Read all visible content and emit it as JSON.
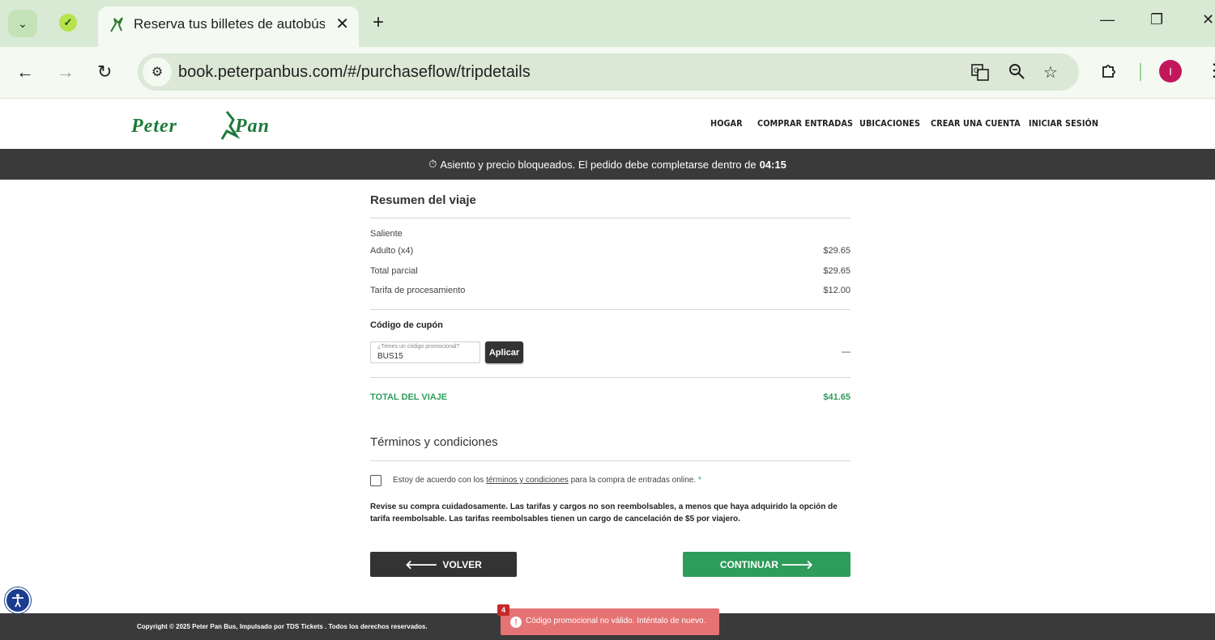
{
  "browser": {
    "tab_title": "Reserva tus billetes de autobús",
    "url": "book.peterpanbus.com/#/purchaseflow/tripdetails",
    "profile_initial": "I"
  },
  "header": {
    "logo_text": "Peter Pan",
    "nav": [
      "HOGAR",
      "COMPRAR ENTRADAS",
      "UBICACIONES",
      "CREAR UNA CUENTA",
      "INICIAR SESIÓN"
    ]
  },
  "timer": {
    "text": "Asiento y precio bloqueados. El pedido debe completarse dentro de",
    "time": "04:15"
  },
  "summary": {
    "title": "Resumen del viaje",
    "direction": "Saliente",
    "rows": [
      {
        "label": "Adulto (x4)",
        "amount": "$29.65"
      },
      {
        "label": "Total parcial",
        "amount": "$29.65"
      },
      {
        "label": "Tarifa de procesamiento",
        "amount": "$12.00"
      }
    ],
    "coupon_title": "Código de cupón",
    "coupon_placeholder": "¿Tienes un código promocional?",
    "coupon_value": "BUS15",
    "apply_label": "Aplicar",
    "coupon_discount": "—",
    "total_label": "TOTAL DEL VIAJE",
    "total_amount": "$41.65"
  },
  "terms": {
    "title": "Términos y condiciones",
    "agree_before": "Estoy de acuerdo con los",
    "agree_link": "términos y condiciones",
    "agree_after": "para la compra de entradas online.",
    "required_mark": "*",
    "notice": "Revise su compra cuidadosamente. Las tarifas y cargos no son reembolsables, a menos que haya adquirido la opción de tarifa reembolsable. Las tarifas reembolsables tienen un cargo de cancelación de $5 por viajero."
  },
  "buttons": {
    "back": "VOLVER",
    "continue": "CONTINUAR"
  },
  "footer": {
    "copyright": "Copyright © 2025 Peter Pan Bus, Impulsado por TDS Tickets . Todos los derechos reservados."
  },
  "toast": {
    "count": "4",
    "message": "Código promocional no válido. Inténtalo de nuevo."
  },
  "colors": {
    "brand_green": "#2e9c5b",
    "dark_bar": "#3a3a3a",
    "error": "#e57373"
  }
}
